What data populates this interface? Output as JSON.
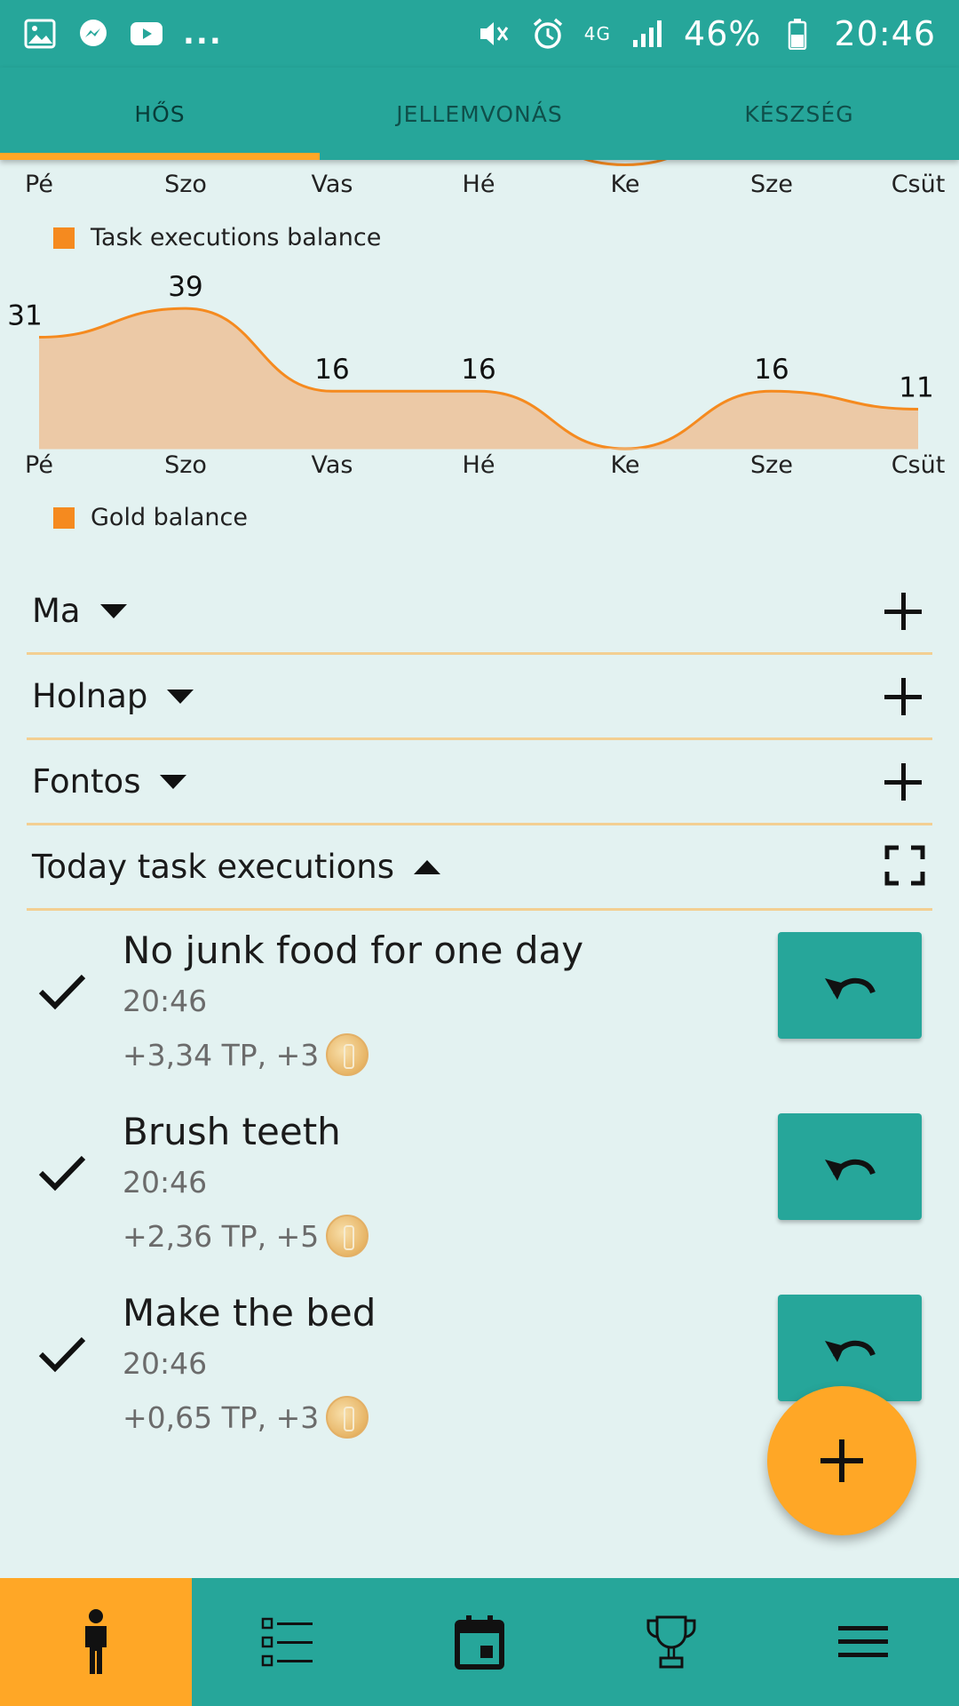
{
  "status_bar": {
    "left_icons": [
      "image-icon",
      "messenger-icon",
      "youtube-icon"
    ],
    "more": "...",
    "network": "4G",
    "battery": "46%",
    "time": "20:46"
  },
  "tabs": [
    {
      "label": "HŐS",
      "active": true
    },
    {
      "label": "JELLEMVONÁS",
      "active": false
    },
    {
      "label": "KÉSZSÉG",
      "active": false
    }
  ],
  "chart_data": [
    {
      "type": "area",
      "title": "",
      "categories": [
        "Pé",
        "Szo",
        "Vas",
        "Hé",
        "Ke",
        "Sze",
        "Csüt"
      ],
      "series": [
        {
          "name": "Task executions balance",
          "values": [
            null,
            null,
            null,
            null,
            -1,
            null,
            null
          ]
        }
      ],
      "legend": "bottom-left"
    },
    {
      "type": "area",
      "title": "",
      "categories": [
        "Pé",
        "Szo",
        "Vas",
        "Hé",
        "Ke",
        "Sze",
        "Csüt"
      ],
      "series": [
        {
          "name": "Gold balance",
          "values": [
            31,
            39,
            16,
            16,
            0,
            16,
            11
          ]
        }
      ],
      "data_labels": [
        "31",
        "39",
        "16",
        "16",
        "",
        "16",
        "11"
      ],
      "ylim": [
        0,
        42
      ],
      "legend": "bottom-left",
      "color": "#f58a1f",
      "fill": "#ecc9a6"
    }
  ],
  "sections": [
    {
      "title": "Ma",
      "expanded": false,
      "action": "plus-icon"
    },
    {
      "title": "Holnap",
      "expanded": false,
      "action": "plus-icon"
    },
    {
      "title": "Fontos",
      "expanded": false,
      "action": "plus-icon"
    },
    {
      "title": "Today task executions",
      "expanded": true,
      "action": "fullscreen-icon"
    }
  ],
  "tasks": [
    {
      "name": "No junk food for one day",
      "time": "20:46",
      "reward": "+3,34 TP, +3"
    },
    {
      "name": "Brush teeth",
      "time": "20:46",
      "reward": "+2,36 TP, +5"
    },
    {
      "name": "Make the bed",
      "time": "20:46",
      "reward": "+0,65 TP, +3"
    }
  ],
  "colors": {
    "primary": "#26a69a",
    "accent": "#ffa726",
    "background": "#e3f2f1",
    "chart_line": "#f58a1f",
    "chart_fill": "#ecc9a6",
    "divider": "#f3cf92"
  },
  "bottom_nav": [
    {
      "icon": "hero-person-icon",
      "active": true
    },
    {
      "icon": "task-list-icon",
      "active": false
    },
    {
      "icon": "calendar-icon",
      "active": false
    },
    {
      "icon": "trophy-icon",
      "active": false
    },
    {
      "icon": "menu-icon",
      "active": false
    }
  ]
}
